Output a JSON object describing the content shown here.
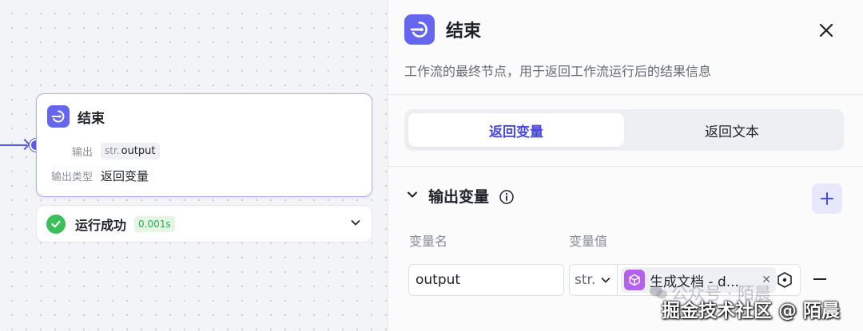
{
  "node": {
    "title": "结束",
    "output_label": "输出",
    "output_type": "str.",
    "output_name": "output",
    "output_kind_label": "输出类型",
    "output_kind_value": "返回变量"
  },
  "status": {
    "text": "运行成功",
    "time": "0.001s",
    "color": "#3cbf5a"
  },
  "panel": {
    "title": "结束",
    "description": "工作流的最终节点，用于返回工作流运行后的结果信息",
    "tabs": [
      {
        "label": "返回变量",
        "active": true
      },
      {
        "label": "返回文本",
        "active": false
      }
    ],
    "section_title": "输出变量",
    "columns": {
      "name": "变量名",
      "value": "变量值"
    },
    "rows": [
      {
        "name": "output",
        "type": "str.",
        "ref": "生成文档 - d..."
      }
    ]
  },
  "watermark": {
    "line1": "公众号 · 陌晨",
    "line2": "掘金技术社区 @ 陌晨"
  },
  "colors": {
    "accent": "#5b5ce6",
    "brand_icon": "#6566f0",
    "ref_icon": "#b461f0"
  }
}
